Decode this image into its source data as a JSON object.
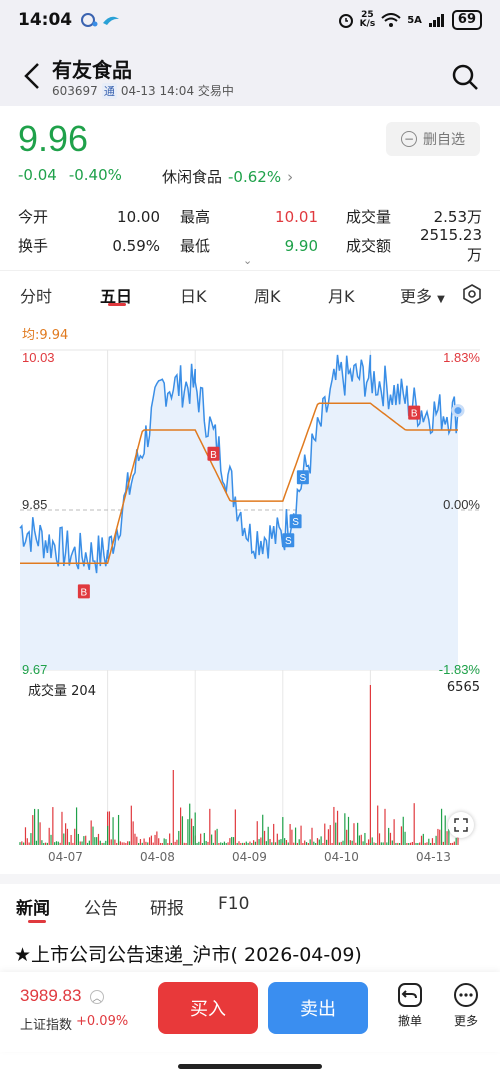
{
  "status_bar": {
    "time": "14:04",
    "network_speed": "25\nK/s",
    "signal_label": "5A",
    "battery": "69"
  },
  "header": {
    "stock_name": "有友食品",
    "stock_code": "603697",
    "tong_badge": "通",
    "trade_status": "04-13 14:04 交易中"
  },
  "quote": {
    "price": "9.96",
    "change": "-0.04",
    "change_pct": "-0.40%",
    "sector_name": "休闲食品",
    "sector_pct": "-0.62%",
    "watch_label": "删自选",
    "stats": {
      "open_label": "今开",
      "open_value": "10.00",
      "high_label": "最高",
      "high_value": "10.01",
      "volume_label": "成交量",
      "volume_value": "2.53万",
      "turnover_label": "换手",
      "turnover_value": "0.59%",
      "low_label": "最低",
      "low_value": "9.90",
      "amount_label": "成交额",
      "amount_value": "2515.23万"
    }
  },
  "chart_tabs": [
    "分时",
    "五日",
    "日K",
    "周K",
    "月K",
    "更多"
  ],
  "active_chart_tab": "五日",
  "chart_labels": {
    "avg": "均:9.94",
    "y_top": "10.03",
    "y_mid": "9.85",
    "y_bottom": "9.67",
    "pct_top": "1.83%",
    "pct_mid": "0.00%",
    "pct_bottom": "-1.83%",
    "volume_label": "成交量",
    "volume_value": "204",
    "volume_max": "6565",
    "dates": [
      "04-07",
      "04-08",
      "04-09",
      "04-10",
      "04-13"
    ],
    "buy_marker": "B",
    "sell_marker": "S"
  },
  "chart_data": {
    "type": "line",
    "title": "",
    "x": [
      "04-07",
      "04-08",
      "04-09",
      "04-10",
      "04-13"
    ],
    "series": [
      {
        "name": "",
        "values": [
          9.8,
          9.99,
          9.82,
          10.0,
          9.96
        ]
      },
      {
        "name": "均",
        "values": [
          9.79,
          9.94,
          9.86,
          9.97,
          9.94
        ]
      }
    ],
    "ylim": [
      9.67,
      10.03
    ],
    "reference": 9.85,
    "volume_max": 6565,
    "color_price": "#3a8ee6",
    "color_avg": "#e07a1f"
  },
  "news_tabs": [
    "新闻",
    "公告",
    "研报",
    "F10"
  ],
  "active_news_tab": "新闻",
  "headline": "★上市公司公告速递_沪市( 2026-04-09)",
  "bottom_bar": {
    "index_value": "3989.83",
    "index_name": "上证指数",
    "index_pct": "+0.09%",
    "buy_label": "买入",
    "sell_label": "卖出",
    "cancel_label": "撤单",
    "more_label": "更多"
  },
  "colors": {
    "up": "#e0393e",
    "down": "#1fa14a",
    "buy_button": "#e8393a",
    "sell_button": "#3a8ef0"
  }
}
